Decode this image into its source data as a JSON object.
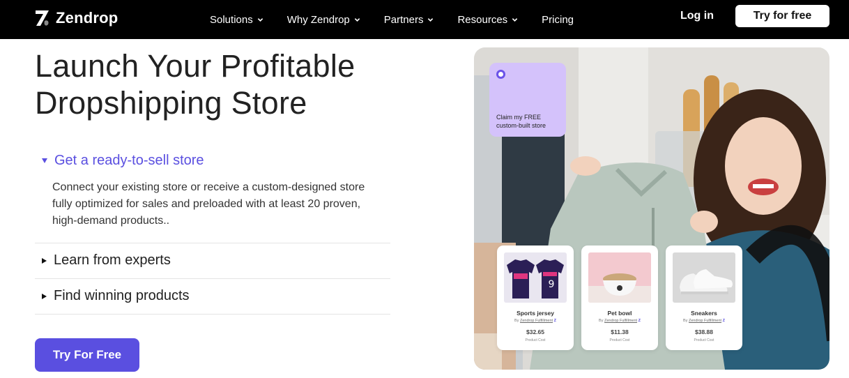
{
  "brand": {
    "name": "Zendrop"
  },
  "nav": {
    "links": [
      {
        "label": "Solutions",
        "dropdown": true
      },
      {
        "label": "Why Zendrop",
        "dropdown": true
      },
      {
        "label": "Partners",
        "dropdown": true
      },
      {
        "label": "Resources",
        "dropdown": true
      },
      {
        "label": "Pricing",
        "dropdown": false
      }
    ],
    "login_label": "Log in",
    "try_label": "Try for free"
  },
  "hero": {
    "title_line1": "Launch Your Profitable",
    "title_line2": "Dropshipping Store",
    "accordion": {
      "open_item": {
        "label": "Get a ready-to-sell store",
        "body": "Connect your existing store or receive a custom-designed store fully optimized for sales and preloaded with at least 20 proven, high-demand products.."
      },
      "items": [
        {
          "label": "Learn from experts"
        },
        {
          "label": "Find winning products"
        }
      ]
    },
    "cta_label": "Try For Free"
  },
  "showcase": {
    "claim_text": "Claim my FREE custom-built store",
    "products": [
      {
        "name": "Sports jersey",
        "by": "By",
        "fulfillment": "Zendrop Fulfillment",
        "price": "$32.65",
        "cost_label": "Product Cost"
      },
      {
        "name": "Pet bowl",
        "by": "By",
        "fulfillment": "Zendrop Fulfillment",
        "price": "$11.38",
        "cost_label": "Product Cost"
      },
      {
        "name": "Sneakers",
        "by": "By",
        "fulfillment": "Zendrop Fulfillment",
        "price": "$38.88",
        "cost_label": "Product Cost"
      }
    ]
  },
  "colors": {
    "accent": "#5a4fe0",
    "nav_bg": "#000000",
    "claim_bg": "#d4c2fb"
  }
}
